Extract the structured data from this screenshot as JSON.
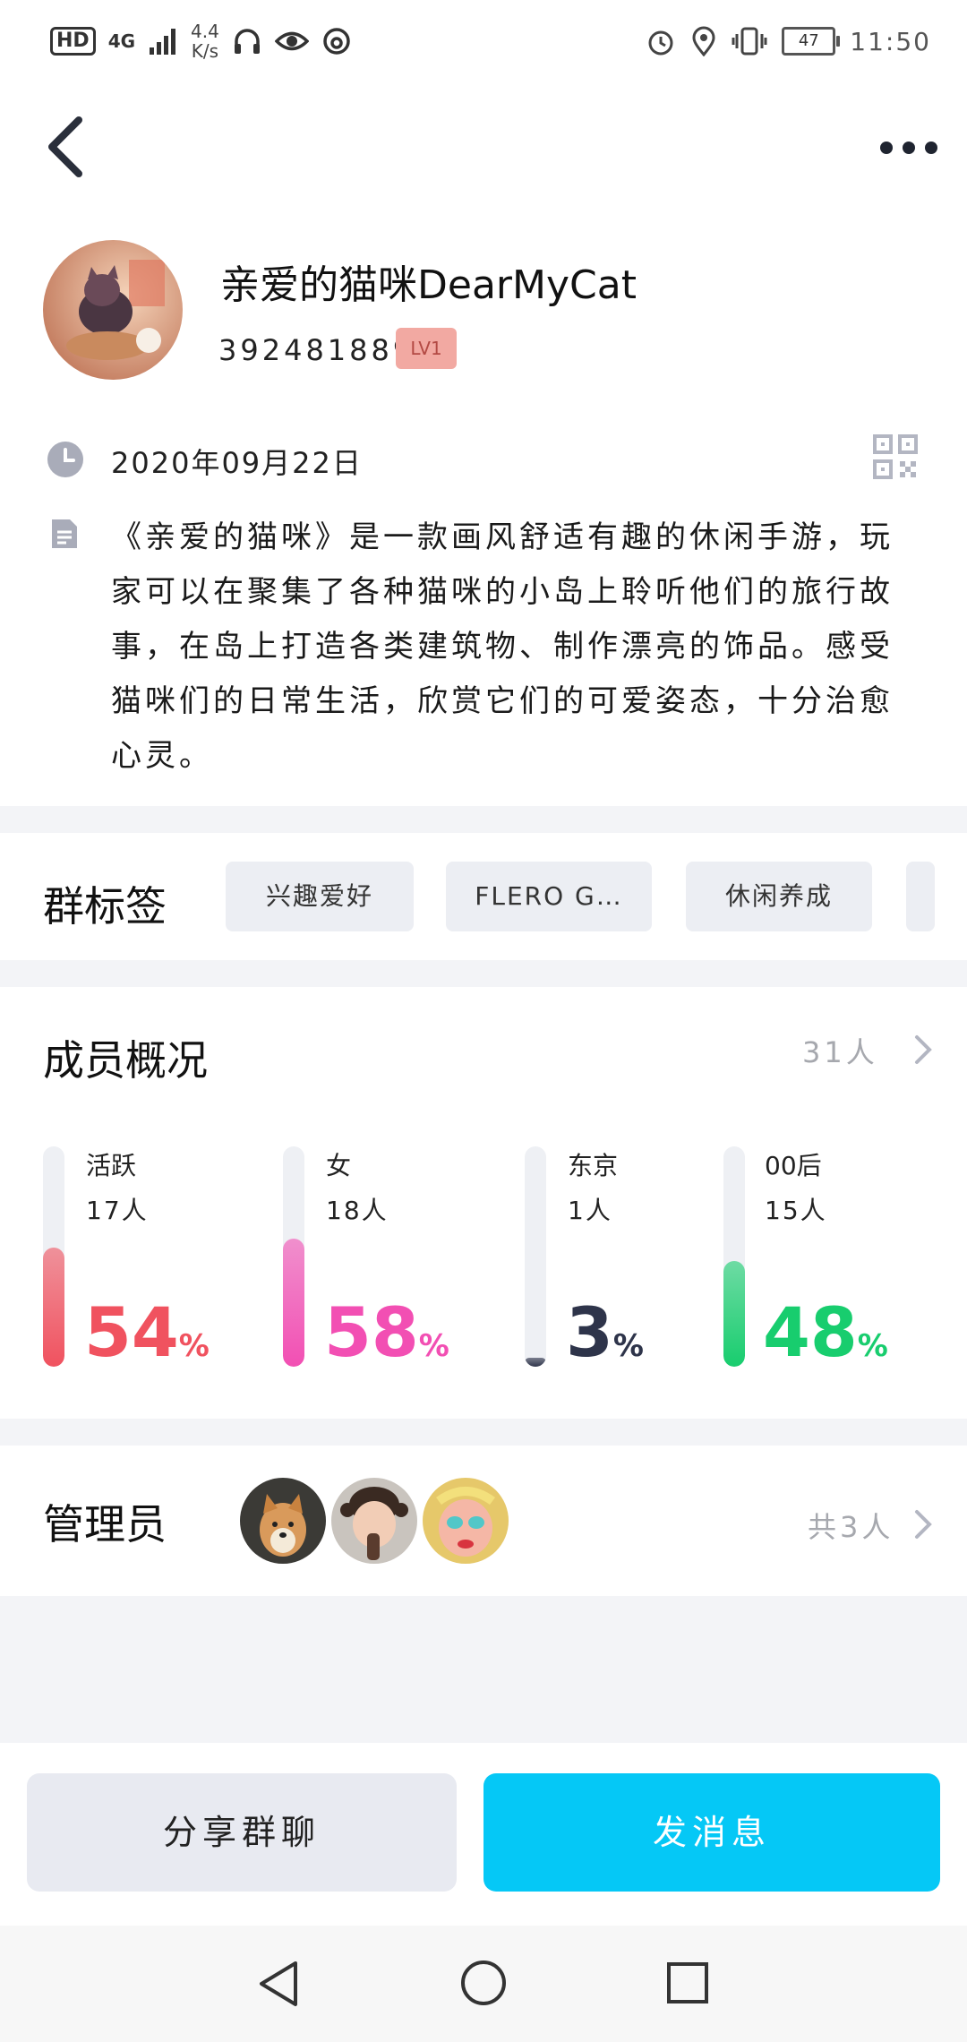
{
  "status_bar": {
    "hd": "HD",
    "network": "4G",
    "speed_value": "4.4",
    "speed_unit": "K/s",
    "battery": "47",
    "time": "11:50"
  },
  "group": {
    "name": "亲爱的猫咪DearMyCat",
    "id": "392481889",
    "level": "LV1",
    "created_date": "2020年09月22日",
    "description": "《亲爱的猫咪》是一款画风舒适有趣的休闲手游，玩家可以在聚集了各种猫咪的小岛上聆听他们的旅行故事，在岛上打造各类建筑物、制作漂亮的饰品。感受猫咪们的日常生活，欣赏它们的可爱姿态，十分治愈心灵。"
  },
  "tags": {
    "title": "群标签",
    "items": [
      "兴趣爱好",
      "FLERO G…",
      "休闲养成",
      ""
    ]
  },
  "members": {
    "title": "成员概况",
    "total": "31人",
    "stats": [
      {
        "label": "活跃",
        "count": "17人",
        "percent": "54",
        "fraction": 0.54,
        "color": "#f0525f"
      },
      {
        "label": "女",
        "count": "18人",
        "percent": "58",
        "fraction": 0.58,
        "color": "#f24fb3"
      },
      {
        "label": "东京",
        "count": "1人",
        "percent": "3",
        "fraction": 0.03,
        "color": "#2e344a"
      },
      {
        "label": "00后",
        "count": "15人",
        "percent": "48",
        "fraction": 0.48,
        "color": "#18cd6e"
      }
    ],
    "percent_sign": "%"
  },
  "admins": {
    "title": "管理员",
    "count": "共3人"
  },
  "actions": {
    "share": "分享群聊",
    "send": "发消息"
  },
  "colors": {
    "accent": "#05c8f6",
    "level_badge": "#f2a9a2"
  }
}
